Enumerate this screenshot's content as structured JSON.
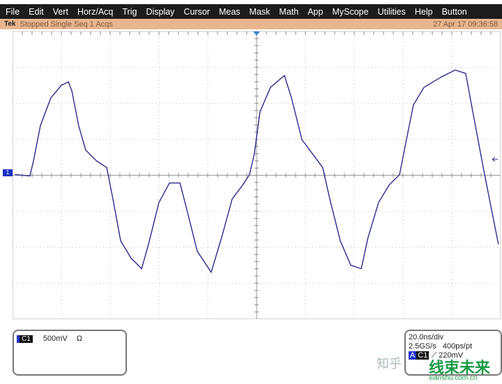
{
  "menu": [
    "File",
    "Edit",
    "Vert",
    "Horz/Acq",
    "Trig",
    "Display",
    "Cursor",
    "Meas",
    "Mask",
    "Math",
    "App",
    "MyScope",
    "Utilities",
    "Help",
    "Button"
  ],
  "status": {
    "brand": "Tek",
    "state": "Stopped Single Seq 1 Acqs",
    "datetime": "27 Apr 17 09:36:58"
  },
  "channel": {
    "label": "C1",
    "marker": "1",
    "scale": "500mV",
    "coupling": "Ω",
    "color": "#1a2fc4"
  },
  "timebase": {
    "horiz": "20.0ns/div",
    "rate": "2.5GS/s",
    "resolution": "400ps/pt",
    "trig_mode": "A",
    "trig_source": "C1",
    "trig_slope": "rising",
    "trig_level": "220mV"
  },
  "watermark": {
    "zhihu": "知乎",
    "brand": "线束未来",
    "url": "xianshu.com.cn"
  },
  "chart_data": {
    "type": "line",
    "time_units": "ns",
    "volt_units": "mV",
    "xlim": [
      -100,
      100
    ],
    "ylim": [
      -2000,
      2000
    ],
    "grid": true,
    "trace_color": "#2b2b8c",
    "series": [
      {
        "t": [
          -99.1,
          -92.9,
          -91.4,
          -88.6,
          -84.3,
          -80,
          -77.1,
          -75.7,
          -72.9,
          -70,
          -65.7,
          -61.4,
          -58.6,
          -55.7,
          -51.4,
          -47.1,
          -44.3,
          -40,
          -35.7,
          -31.4,
          -28.6,
          -24.3,
          -18.6,
          -14.3,
          -10,
          -5.7,
          -2.9,
          -0.9,
          1.4,
          5.7,
          11.4,
          14.3,
          18.6,
          22.9,
          27.1,
          30,
          34.3,
          38.6,
          42.9,
          45.7,
          50,
          54.3,
          58.6,
          61.4,
          64.3,
          68.6,
          75.7,
          81.4,
          85.7,
          88.6,
          92.9,
          95.7,
          99.1
        ],
        "v": [
          10,
          -10,
          203,
          688,
          1076,
          1250,
          1298,
          1172,
          688,
          349,
          203,
          107,
          -378,
          -911,
          -1153,
          -1298,
          -959,
          -378,
          -107,
          -107,
          -475,
          -1056,
          -1347,
          -862,
          -329,
          -136,
          10,
          300,
          882,
          1221,
          1386,
          1076,
          494,
          300,
          107,
          -329,
          -911,
          -1250,
          -1298,
          -862,
          -378,
          -136,
          10,
          494,
          979,
          1221,
          1366,
          1463,
          1415,
          882,
          107,
          -378,
          -959
        ]
      }
    ]
  }
}
